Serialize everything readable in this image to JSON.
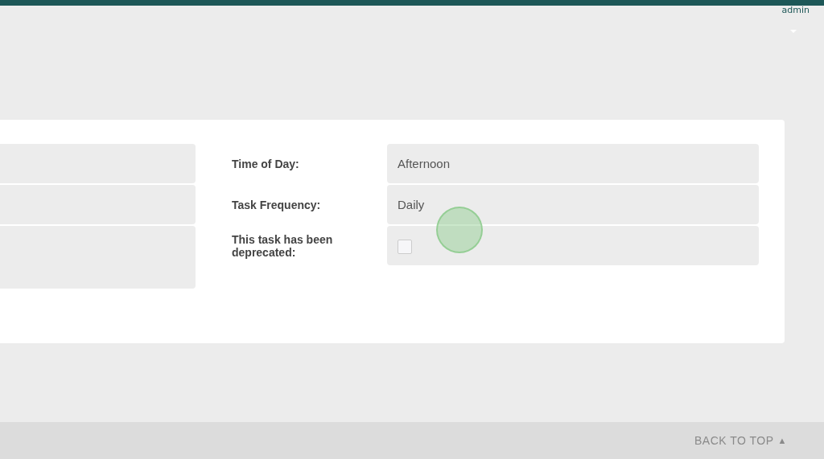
{
  "header": {
    "user": "admin"
  },
  "form": {
    "fields": [
      {
        "kind": "text",
        "label": "Time of Day:",
        "value": "Afternoon"
      },
      {
        "kind": "text",
        "label": "Task Frequency:",
        "value": "Daily"
      },
      {
        "kind": "checkbox",
        "label": "This task has been deprecated:",
        "checked": false
      }
    ]
  },
  "footer": {
    "back_to_top": "BACK TO TOP",
    "arrow": "▲"
  }
}
